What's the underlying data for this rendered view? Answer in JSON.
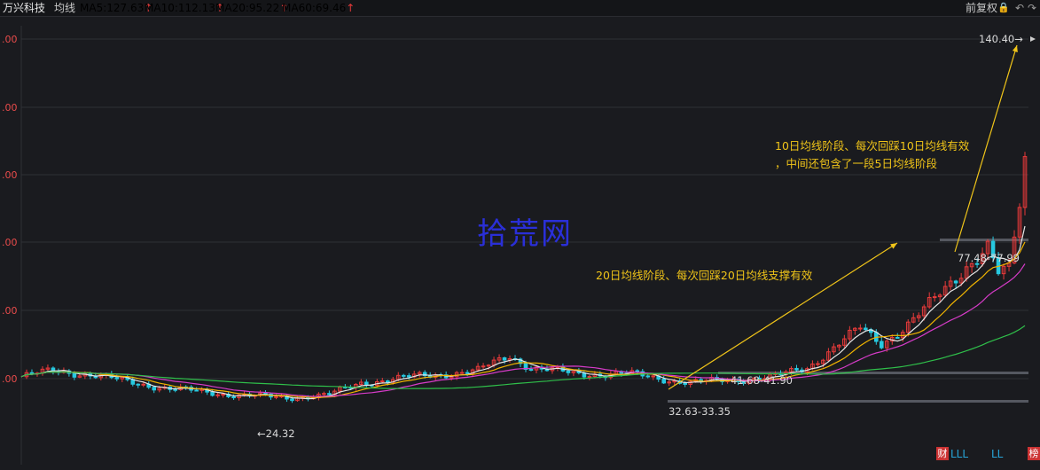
{
  "header": {
    "stock_name": "万兴科技",
    "ma_label": "均线",
    "ma5": "MA5:127.63",
    "ma10": "MA10:112.13",
    "ma20": "MA20:95.22",
    "ma60": "MA60:69.46",
    "up_arrow": "↑",
    "fuquan": "前复权",
    "lock_icon": "🔒",
    "undo_icon": "↶",
    "redo_icon": "↷"
  },
  "colors": {
    "up": "#e83a3a",
    "down": "#27c9e0",
    "ma5": "#e6e6e6",
    "ma10": "#f0b400",
    "ma20": "#d63bc8",
    "ma60": "#2fbf4a",
    "annotation": "#f0c419"
  },
  "chart_data": {
    "type": "candlestick",
    "y_tick_labels": [
      ".00",
      ".00",
      ".00",
      ".00",
      ".00",
      ".00"
    ],
    "ylim": [
      20,
      145
    ],
    "grid": true,
    "series": [
      {
        "name": "MA5",
        "value": 127.63
      },
      {
        "name": "MA10",
        "value": 112.13
      },
      {
        "name": "MA20",
        "value": 95.22
      },
      {
        "name": "MA60",
        "value": 69.46
      }
    ],
    "annotations": {
      "low_label": "←24.32",
      "range_label_1": "32.63-33.35",
      "range_label_2": "41.68-41.90",
      "range_label_3": "77.48-77.99",
      "high_label": "140.40→",
      "note_20day": "20日均线阶段、每次回踩20日均线支撑有效",
      "note_10day_line1": "10日均线阶段、每次回踩10日均线有效",
      "note_10day_line2": "，中间还包含了一段5日均线阶段",
      "watermark": "拾荒网"
    }
  },
  "footer": {
    "cai": "财",
    "lll": "LLL",
    "ll": "LL",
    "bang": "榜"
  }
}
